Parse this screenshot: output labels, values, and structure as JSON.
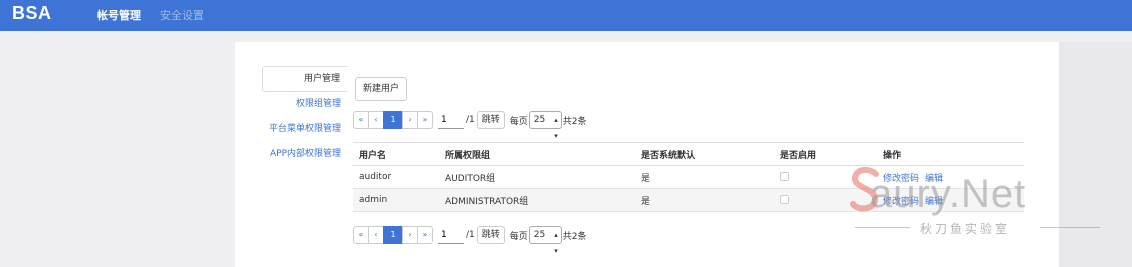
{
  "header": {
    "brand": "BSA",
    "nav": [
      {
        "label": "帐号管理",
        "active": true
      },
      {
        "label": "安全设置",
        "active": false
      }
    ]
  },
  "sidebar": {
    "items": [
      {
        "label": "用户管理",
        "active": true
      },
      {
        "label": "权限组管理",
        "active": false
      },
      {
        "label": "平台菜单权限管理",
        "active": false
      },
      {
        "label": "APP内部权限管理",
        "active": false
      }
    ]
  },
  "toolbar": {
    "new_user_label": "新建用户"
  },
  "pagination": {
    "first": "«",
    "prev": "‹",
    "current": "1",
    "next": "›",
    "last": "»",
    "page_input": "1",
    "total_pages": "/1",
    "jump_label": "跳转",
    "per_page_label": "每页",
    "per_page_value": "25",
    "count_label": "共2条"
  },
  "table": {
    "columns": [
      "用户名",
      "所属权限组",
      "是否系统默认",
      "是否启用",
      "操作"
    ],
    "rows": [
      {
        "username": "auditor",
        "group": "AUDITOR组",
        "system_default": "是",
        "enabled": false,
        "actions": [
          "修改密码",
          "编辑"
        ]
      },
      {
        "username": "admin",
        "group": "ADMINISTRATOR组",
        "system_default": "是",
        "enabled": false,
        "actions": [
          "修改密码",
          "编辑"
        ]
      }
    ]
  },
  "watermark": {
    "text": "aury.Net",
    "subtitle": "秋刀鱼实验室"
  },
  "colors": {
    "header_bg": "#3d74d6",
    "link": "#3d74d6",
    "page_bg": "#f0f0f2"
  }
}
